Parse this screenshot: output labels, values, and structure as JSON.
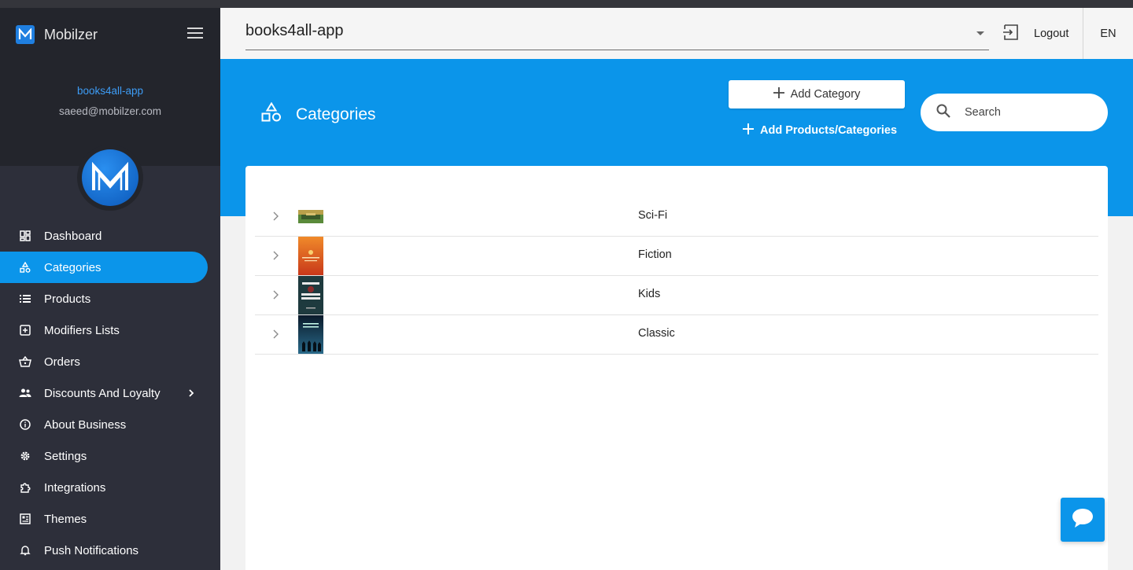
{
  "sidebar": {
    "brand": "Mobilzer",
    "app_name": "books4all-app",
    "user_email": "saeed@mobilzer.com",
    "items": [
      {
        "label": "Dashboard",
        "icon": "dashboard-icon"
      },
      {
        "label": "Categories",
        "icon": "shapes-icon",
        "active": true
      },
      {
        "label": "Products",
        "icon": "list-icon"
      },
      {
        "label": "Modifiers Lists",
        "icon": "plus-box-icon"
      },
      {
        "label": "Orders",
        "icon": "basket-icon"
      },
      {
        "label": "Discounts And Loyalty",
        "icon": "people-icon",
        "has_submenu": true
      },
      {
        "label": "About Business",
        "icon": "info-icon"
      },
      {
        "label": "Settings",
        "icon": "gear-icon"
      },
      {
        "label": "Integrations",
        "icon": "puzzle-icon"
      },
      {
        "label": "Themes",
        "icon": "theme-icon"
      },
      {
        "label": "Push Notifications",
        "icon": "bell-icon"
      }
    ]
  },
  "topbar": {
    "app_selector_value": "books4all-app",
    "logout_label": "Logout",
    "language": "EN"
  },
  "header": {
    "title": "Categories",
    "add_category_label": "Add Category",
    "add_products_label": "Add Products/Categories",
    "search_placeholder": "Search"
  },
  "categories": [
    {
      "name": "Sci-Fi"
    },
    {
      "name": "Fiction"
    },
    {
      "name": "Kids"
    },
    {
      "name": "Classic"
    }
  ],
  "colors": {
    "accent": "#0b95ea",
    "sidebar_bg": "#2d2f3a",
    "sidebar_header_bg": "#23252c",
    "link": "#3d9cf5"
  }
}
